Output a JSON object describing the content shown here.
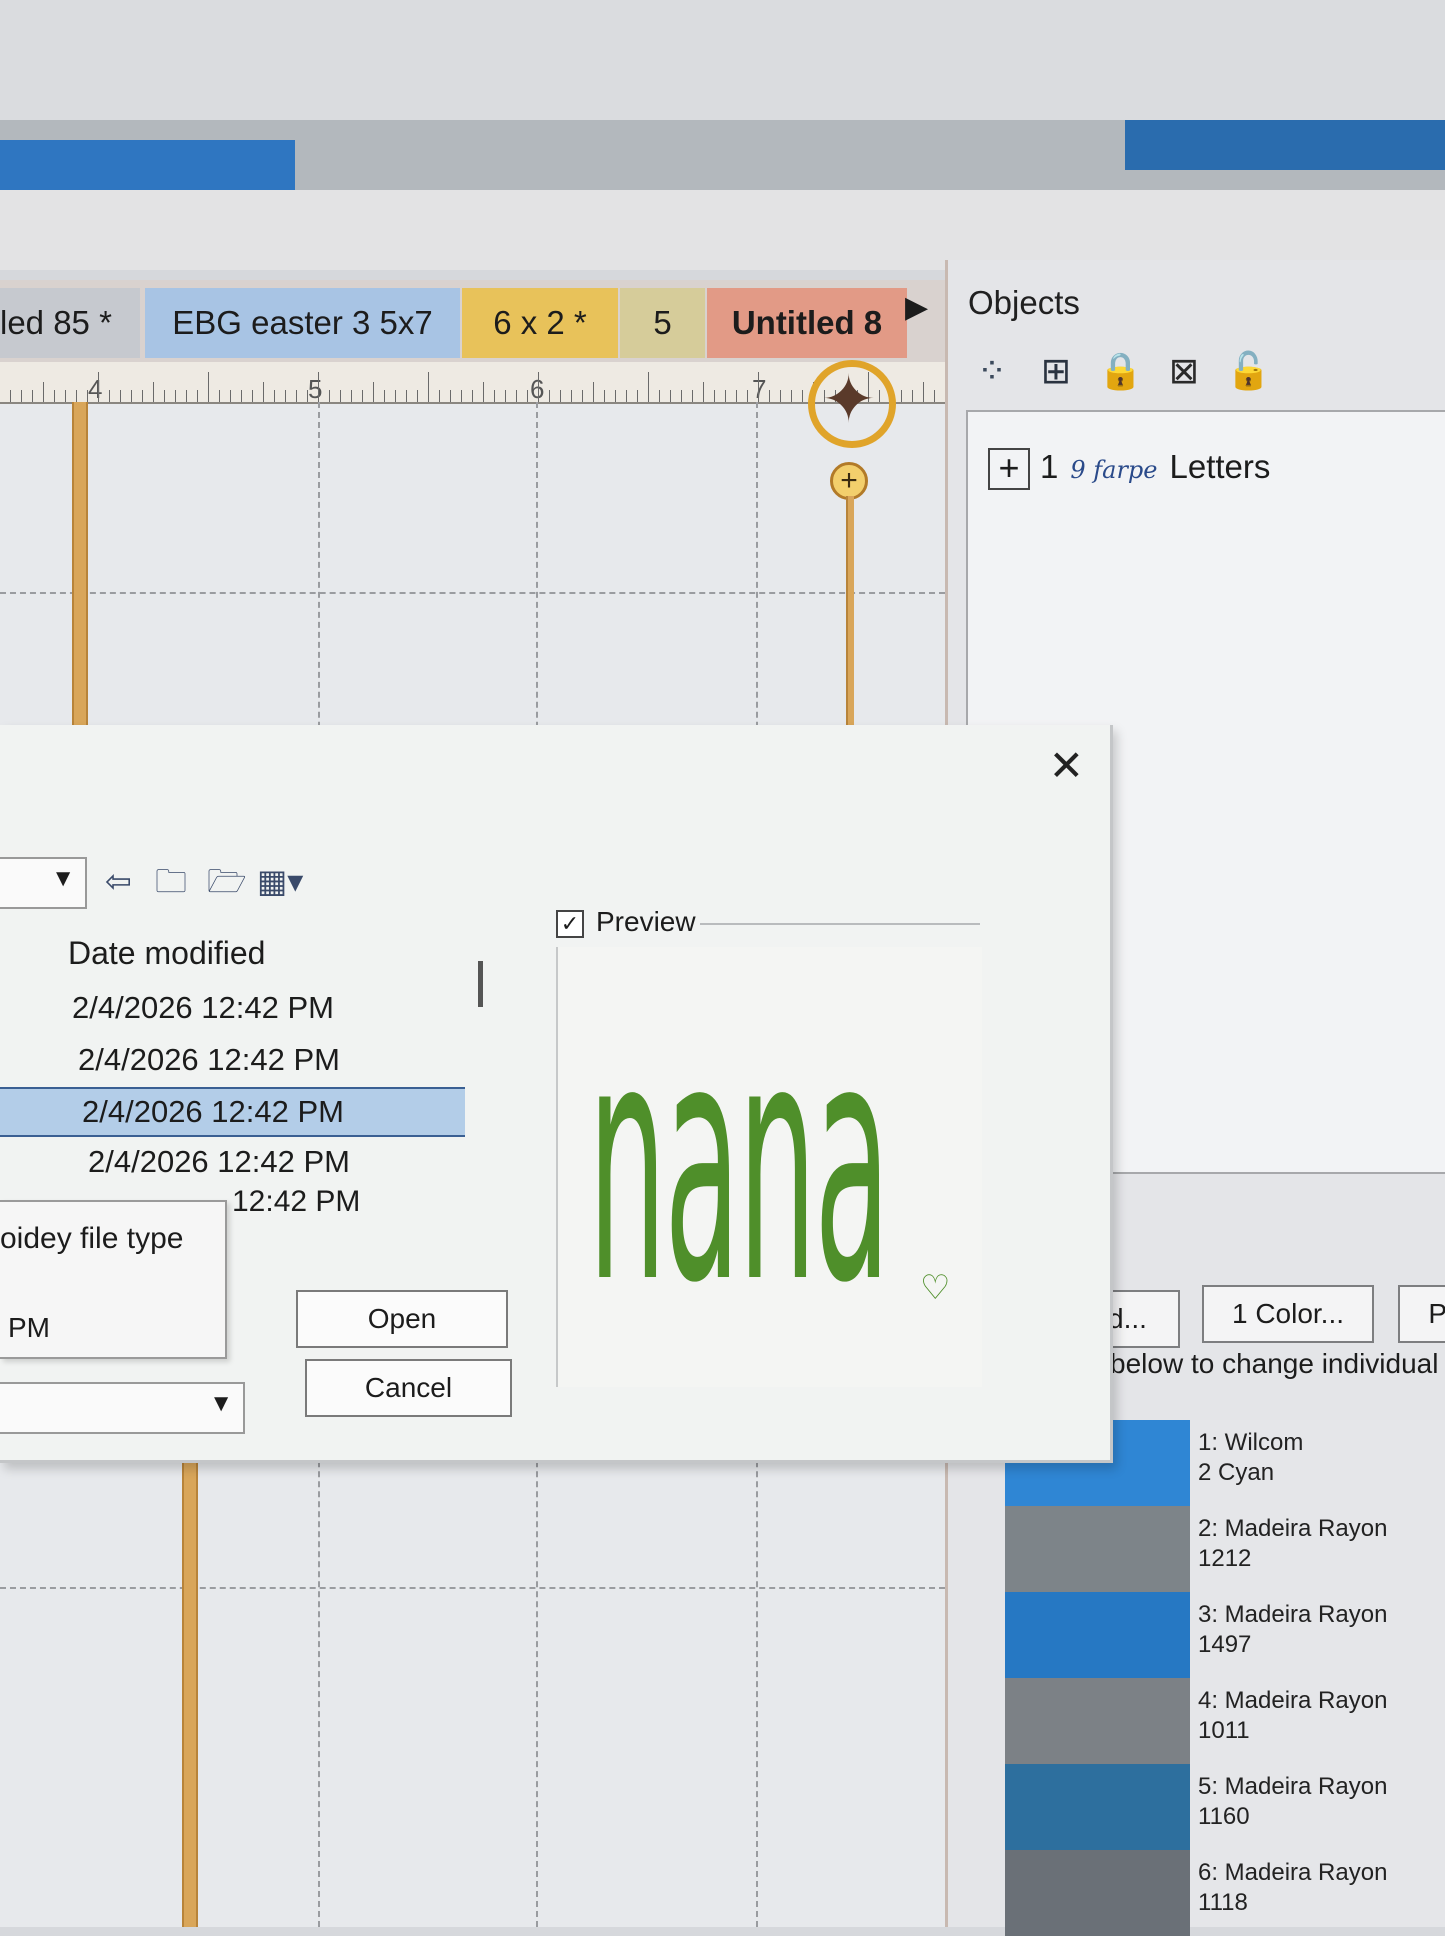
{
  "tabs": [
    {
      "label": "led 85 *"
    },
    {
      "label": "EBG easter 3 5x7"
    },
    {
      "label": "6 x 2 *"
    },
    {
      "label": "5"
    },
    {
      "label": "Untitled 8"
    }
  ],
  "ruler": {
    "marks": [
      "4",
      "5",
      "6",
      "7"
    ]
  },
  "objects_panel": {
    "title": "Objects",
    "items": [
      {
        "index": "1",
        "signature": "9 farpe",
        "label": "Letters"
      }
    ],
    "toolbar_icons": [
      "group-icon",
      "ungroup-icon",
      "lock-icon",
      "lock-cross-icon",
      "unlock-icon"
    ]
  },
  "color_panel": {
    "button_partial": "d...",
    "one_color_button": "1 Color...",
    "next_button_partial": "P",
    "hint": "below to change individual co",
    "colors": [
      {
        "name": "1: Wilcom",
        "code": "2 Cyan",
        "color": "#2f86d4"
      },
      {
        "name": "2: Madeira Rayon",
        "code": "1212",
        "color": "#7d8489"
      },
      {
        "name": "3: Madeira Rayon",
        "code": "1497",
        "color": "#2678c3"
      },
      {
        "name": "4: Madeira Rayon",
        "code": "1011",
        "color": "#7c8186"
      },
      {
        "name": "5: Madeira Rayon",
        "code": "1160",
        "color": "#2d6f9e"
      },
      {
        "name": "6: Madeira Rayon",
        "code": "1118",
        "color": "#6a7077"
      }
    ]
  },
  "dialog": {
    "column_header": "Date modified",
    "files": [
      {
        "date": "2/4/2026 12:42 PM"
      },
      {
        "date": "2/4/2026 12:42 PM"
      },
      {
        "date": "2/4/2026 12:42 PM"
      },
      {
        "date": "2/4/2026 12:42 PM"
      }
    ],
    "selected_index": 2,
    "partial_time": "12:42 PM",
    "file_type_label": "oidey file type",
    "file_type_value": "PM",
    "open_button": "Open",
    "cancel_button": "Cancel",
    "preview_label": "Preview",
    "preview_checked": true,
    "preview_text": "nana",
    "preview_color": "#4f8f2a"
  }
}
